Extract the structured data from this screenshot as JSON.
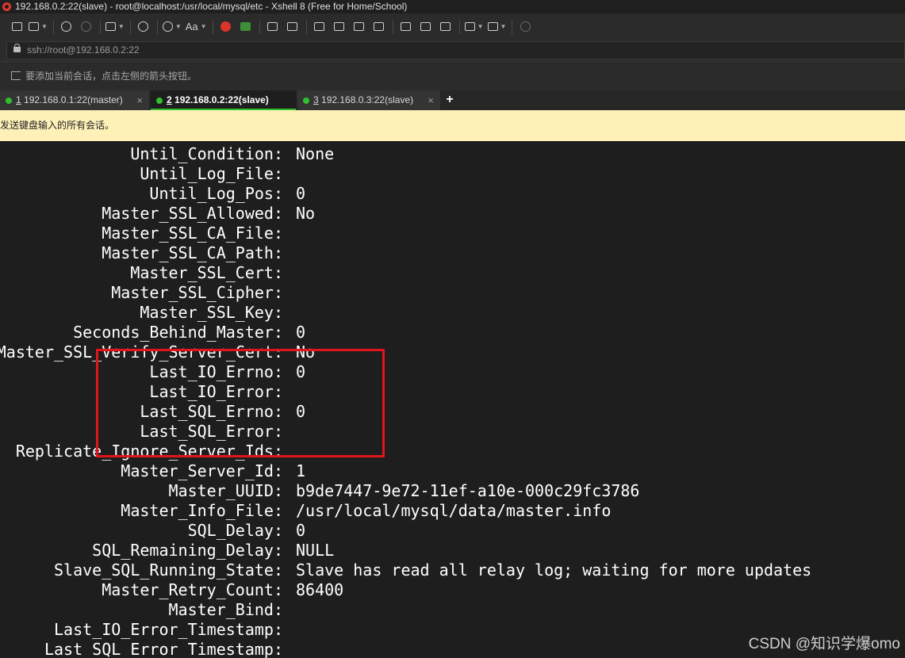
{
  "window": {
    "title": "192.168.0.2:22(slave) - root@localhost:/usr/local/mysql/etc - Xshell 8 (Free for Home/School)",
    "app_icon": "xshell-logo-icon"
  },
  "toolbar": {
    "buttons": [
      {
        "name": "new-session-icon",
        "dropdown": false
      },
      {
        "name": "open-session-icon",
        "dropdown": true
      },
      {
        "name": "disconnect-icon",
        "dropdown": false
      },
      {
        "name": "reconnect-icon",
        "dropdown": false
      },
      {
        "name": "transfer-icon",
        "dropdown": true
      },
      {
        "name": "find-icon",
        "dropdown": false
      },
      {
        "name": "globe-icon",
        "dropdown": true
      },
      {
        "name": "font-icon",
        "dropdown": true,
        "label": "Aa"
      },
      {
        "name": "xshell-icon",
        "dropdown": false
      },
      {
        "name": "xftp-icon",
        "dropdown": false
      },
      {
        "name": "fullscreen-icon",
        "dropdown": false
      },
      {
        "name": "lock-icon",
        "dropdown": false
      },
      {
        "name": "keyboard-icon",
        "dropdown": false
      },
      {
        "name": "compose-icon",
        "dropdown": false
      },
      {
        "name": "send-icon",
        "dropdown": false
      },
      {
        "name": "script-icon",
        "dropdown": false
      },
      {
        "name": "record-icon",
        "dropdown": false
      },
      {
        "name": "log-icon",
        "dropdown": false
      },
      {
        "name": "notes-icon",
        "dropdown": false
      },
      {
        "name": "new-tab-icon",
        "dropdown": true
      },
      {
        "name": "layout-icon",
        "dropdown": true
      },
      {
        "name": "help-icon",
        "dropdown": false
      }
    ]
  },
  "address": {
    "url": "ssh://root@192.168.0.2:22"
  },
  "hint": {
    "text": "要添加当前会话，点击左侧的箭头按钮。"
  },
  "tabs": [
    {
      "num": "1",
      "label": "192.168.0.1:22(master)",
      "active": false,
      "status_color": "#2fbf2f"
    },
    {
      "num": "2",
      "label": "192.168.0.2:22(slave)",
      "active": true,
      "status_color": "#2fbf2f"
    },
    {
      "num": "3",
      "label": "192.168.0.3:22(slave)",
      "active": false,
      "status_color": "#2fbf2f"
    }
  ],
  "tab_close_glyph": "×",
  "add_tab_glyph": "+",
  "broadcast": {
    "text": "发送键盘输入的所有会话。"
  },
  "terminal": {
    "lines": [
      {
        "key": "Until_Condition:",
        "value": "None"
      },
      {
        "key": "Until_Log_File:",
        "value": ""
      },
      {
        "key": "Until_Log_Pos:",
        "value": "0"
      },
      {
        "key": "Master_SSL_Allowed:",
        "value": "No"
      },
      {
        "key": "Master_SSL_CA_File:",
        "value": ""
      },
      {
        "key": "Master_SSL_CA_Path:",
        "value": ""
      },
      {
        "key": "Master_SSL_Cert:",
        "value": ""
      },
      {
        "key": "Master_SSL_Cipher:",
        "value": ""
      },
      {
        "key": "Master_SSL_Key:",
        "value": ""
      },
      {
        "key": "Seconds_Behind_Master:",
        "value": "0"
      },
      {
        "key": "Master_SSL_Verify_Server_Cert:",
        "value": "No"
      },
      {
        "key": "Last_IO_Errno:",
        "value": "0"
      },
      {
        "key": "Last_IO_Error:",
        "value": ""
      },
      {
        "key": "Last_SQL_Errno:",
        "value": "0"
      },
      {
        "key": "Last_SQL_Error:",
        "value": ""
      },
      {
        "key": "Replicate_Ignore_Server_Ids:",
        "value": ""
      },
      {
        "key": "Master_Server_Id:",
        "value": "1"
      },
      {
        "key": "Master_UUID:",
        "value": "b9de7447-9e72-11ef-a10e-000c29fc3786"
      },
      {
        "key": "Master_Info_File:",
        "value": "/usr/local/mysql/data/master.info"
      },
      {
        "key": "SQL_Delay:",
        "value": "0"
      },
      {
        "key": "SQL_Remaining_Delay:",
        "value": "NULL"
      },
      {
        "key": "Slave_SQL_Running_State:",
        "value": "Slave has read all relay log; waiting for more updates"
      },
      {
        "key": "Master_Retry_Count:",
        "value": "86400"
      },
      {
        "key": "Master_Bind:",
        "value": ""
      },
      {
        "key": "Last_IO_Error_Timestamp:",
        "value": ""
      },
      {
        "key": "Last_SQL_Error_Timestamp:",
        "value": ""
      }
    ],
    "highlight_color": "#e3141c"
  },
  "watermark": "CSDN @知识学爆omo"
}
